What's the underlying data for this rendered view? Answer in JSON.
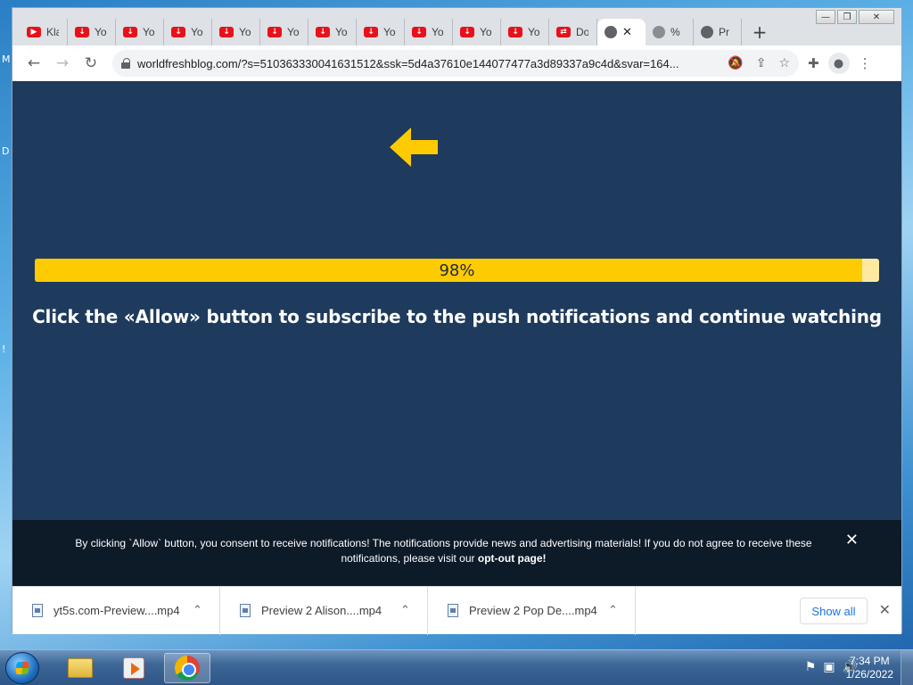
{
  "window": {
    "controls": {
      "minimize": "—",
      "maximize": "❐",
      "close": "✕"
    }
  },
  "tabs": [
    {
      "title": "Kla",
      "icon": "youtube-icon"
    },
    {
      "title": "Yo",
      "icon": "download-icon"
    },
    {
      "title": "Yo",
      "icon": "download-icon"
    },
    {
      "title": "Yo",
      "icon": "download-icon"
    },
    {
      "title": "Yo",
      "icon": "download-icon"
    },
    {
      "title": "Yo",
      "icon": "download-icon"
    },
    {
      "title": "Yo",
      "icon": "download-icon"
    },
    {
      "title": "Yo",
      "icon": "download-icon"
    },
    {
      "title": "Yo",
      "icon": "download-icon"
    },
    {
      "title": "Yo",
      "icon": "download-icon"
    },
    {
      "title": "Yo",
      "icon": "download-icon"
    },
    {
      "title": "Do",
      "icon": "convert-icon"
    },
    {
      "title": "",
      "icon": "globe-icon",
      "active": true
    },
    {
      "title": "%",
      "icon": "globe-icon"
    },
    {
      "title": "Pr",
      "icon": "globe-icon"
    }
  ],
  "toolbar": {
    "url": "worldfreshblog.com/?s=510363330041631512&ssk=5d4a37610e144077477a3d89337a9c4d&svar=164..."
  },
  "page": {
    "progress_label": "98%",
    "progress_value": 0.98,
    "instruction": "Click the «Allow» button to subscribe to the push notifications and continue watching",
    "consent_text": "By clicking `Allow` button, you consent to receive notifications! The notifications provide news and advertising materials! If you do not agree to receive these notifications, please visit our ",
    "consent_link": "opt-out page!",
    "accent_color": "#fecb00",
    "background_color": "#1e3a5c"
  },
  "downloads": {
    "items": [
      {
        "name": "yt5s.com-Preview....mp4"
      },
      {
        "name": "Preview 2 Alison....mp4"
      },
      {
        "name": "Preview 2 Pop De....mp4"
      }
    ],
    "show_all": "Show all"
  },
  "taskbar": {
    "time": "7:34 PM",
    "date": "1/26/2022"
  }
}
